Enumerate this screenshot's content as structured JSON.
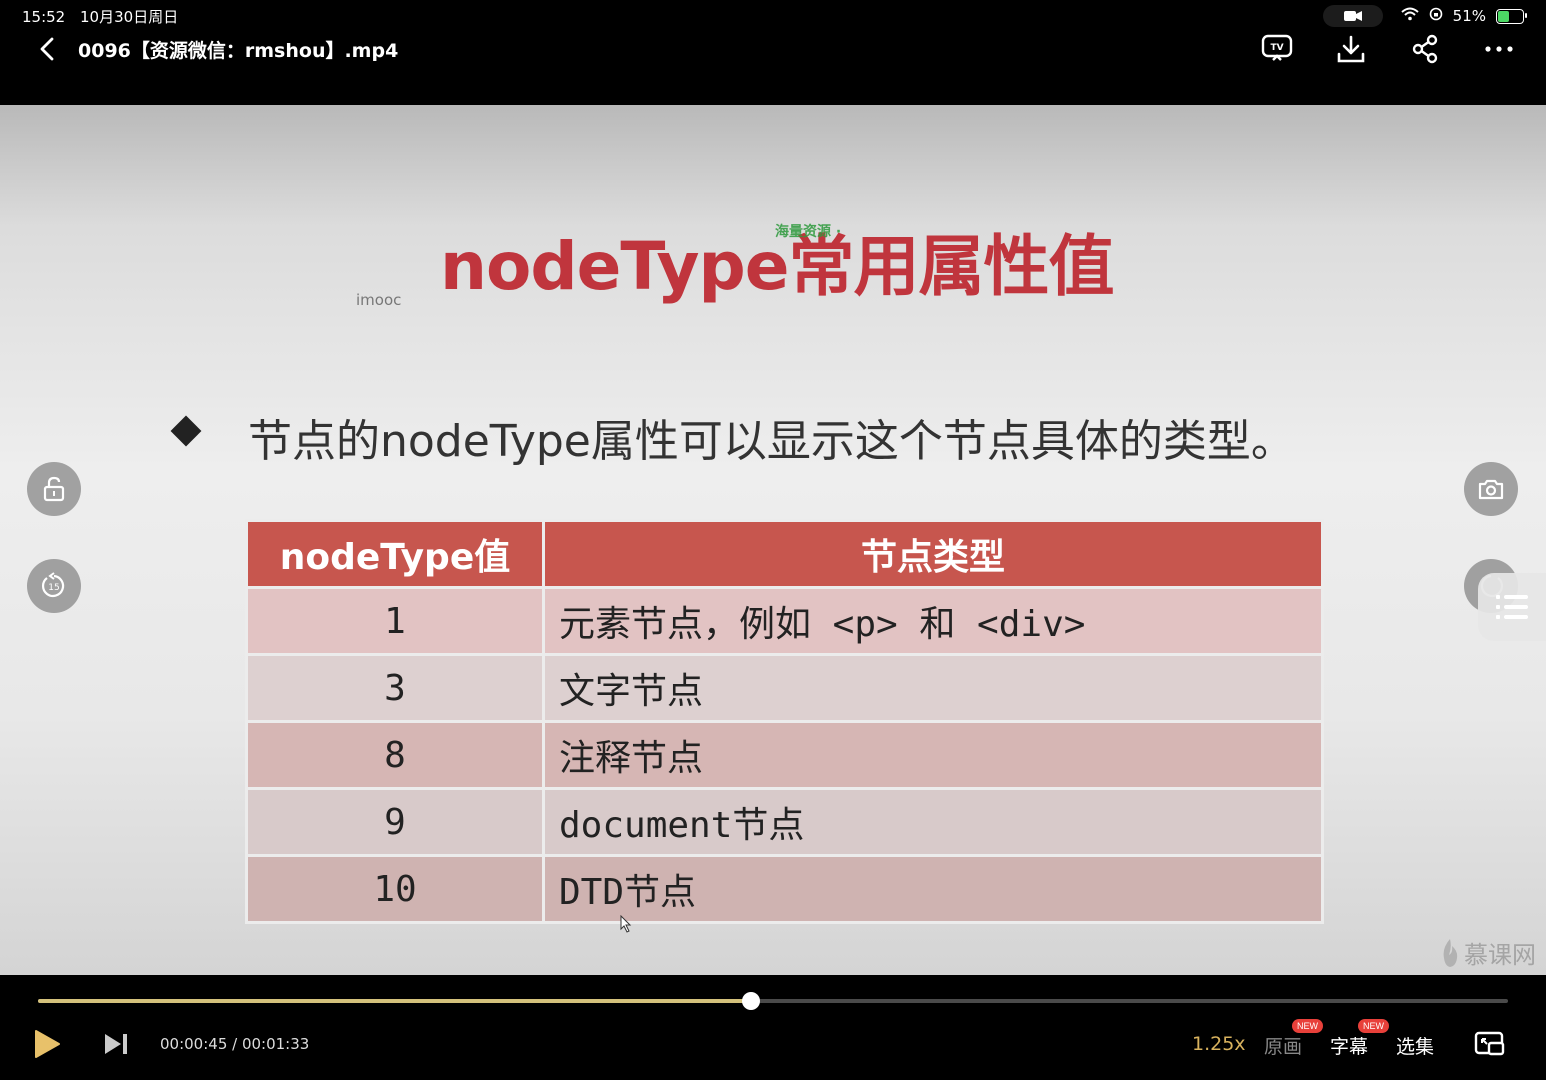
{
  "status_bar": {
    "time": "15:52",
    "date": "10月30日周日",
    "battery": "51%",
    "battery_level": 0.51
  },
  "header": {
    "back_icon": "chevron-left-icon",
    "title": "0096【资源微信：rmshou】.mp4",
    "icons": [
      "tv-cast-icon",
      "download-icon",
      "share-icon",
      "more-icon"
    ]
  },
  "slide": {
    "title": "nodeType常用属性值",
    "overlay_watermark": "海量资源 · ",
    "imooc_label": "imooc",
    "bullet_text": "节点的nodeType属性可以显示这个节点具体的类型。",
    "table": {
      "headers": [
        "nodeType值",
        "节点类型"
      ],
      "rows": [
        {
          "value": "1",
          "type": "元素节点，例如 <p> 和 <div>"
        },
        {
          "value": "3",
          "type": "文字节点"
        },
        {
          "value": "8",
          "type": "注释节点"
        },
        {
          "value": "9",
          "type": "document节点"
        },
        {
          "value": "10",
          "type": "DTD节点"
        }
      ]
    },
    "brand": "慕课网"
  },
  "player": {
    "current_time": "00:00:45",
    "duration": "00:01:33",
    "time_display": "00:00:45 / 00:01:33",
    "progress": 0.4847,
    "speed": "1.25x",
    "quality_label": "原画",
    "subtitle_label": "字幕",
    "episodes_label": "选集",
    "new_badge": "NEW",
    "accent_color": "#d4c17c"
  }
}
